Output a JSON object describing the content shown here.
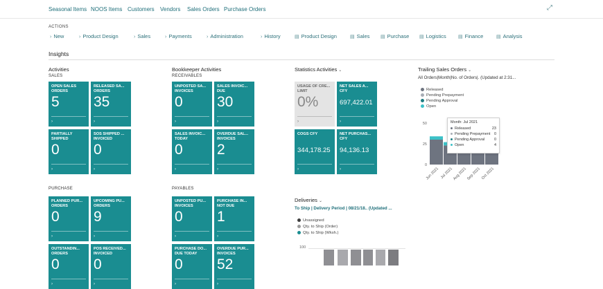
{
  "top_nav": [
    "Seasonal Items",
    "NOOS Items",
    "Customers",
    "Vendors",
    "Sales Orders",
    "Purchase Orders"
  ],
  "actions_label": "ACTIONS",
  "actions": [
    {
      "label": "New",
      "icon": "chevron-right-icon"
    },
    {
      "label": "Product Design",
      "icon": "chevron-right-icon"
    },
    {
      "label": "Sales",
      "icon": "chevron-right-icon"
    },
    {
      "label": "Payments",
      "icon": "chevron-right-icon"
    },
    {
      "label": "Administration",
      "icon": "chevron-right-icon"
    },
    {
      "label": "History",
      "icon": "chevron-right-icon"
    },
    {
      "label": "Product Design",
      "icon": "document-icon"
    },
    {
      "label": "Sales",
      "icon": "document-icon"
    },
    {
      "label": "Purchase",
      "icon": "document-icon"
    },
    {
      "label": "Logistics",
      "icon": "document-icon"
    },
    {
      "label": "Finance",
      "icon": "document-icon"
    },
    {
      "label": "Analysis",
      "icon": "document-icon"
    }
  ],
  "insights_title": "Insights",
  "activities": {
    "title": "Activities",
    "sales_label": "SALES",
    "purchase_label": "PURCHASE",
    "sales_tiles": [
      {
        "title": "OPEN SALES\nORDERS",
        "value": "5"
      },
      {
        "title": "RELEASED SA...\nORDERS",
        "value": "35"
      },
      {
        "title": "PARTIALLY\nSHIPPED",
        "value": "0"
      },
      {
        "title": "SOS SHIPPED ...\nINVOICED",
        "value": "0"
      }
    ],
    "purchase_tiles": [
      {
        "title": "PLANNED PUR...\nORDERS",
        "value": "0"
      },
      {
        "title": "UPCOMING PU...\nORDERS",
        "value": "9"
      },
      {
        "title": "OUTSTANDIN...\nORDERS",
        "value": "0"
      },
      {
        "title": "POS RECEIVED...\nINVOICED",
        "value": "0"
      }
    ]
  },
  "bookkeeper": {
    "title": "Bookkeeper Activities",
    "receivables_label": "RECEIVABLES",
    "payables_label": "PAYABLES",
    "receivable_tiles": [
      {
        "title": "UNPOSTED SA...\nINVOICES",
        "value": "0"
      },
      {
        "title": "SALES INVOIC...\nDUE",
        "value": "30"
      },
      {
        "title": "SALES INVOIC...\nTODAY",
        "value": "0"
      },
      {
        "title": "OVERDUE SAL...\nINVOICES",
        "value": "2"
      }
    ],
    "payable_tiles": [
      {
        "title": "UNPOSTED PU...\nINVOICES",
        "value": "0"
      },
      {
        "title": "PURCHASE IN...\nNOT DUE",
        "value": "1"
      },
      {
        "title": "PURCHASE DO...\nDUE TODAY",
        "value": "0"
      },
      {
        "title": "OVERDUE PUR...\nINVOICES",
        "value": "52"
      }
    ]
  },
  "statistics": {
    "title": "Statistics Activities",
    "tiles": [
      {
        "title": "USAGE OF CRE...\nLIMIT",
        "value": "0%"
      },
      {
        "title": "NET SALES A...\nCFY",
        "value": "697,422.01"
      },
      {
        "title": "COGS CFY",
        "value": "344,178.25"
      },
      {
        "title": "NET PURCHAS...\nCFY",
        "value": "94,136.13"
      }
    ]
  },
  "deliveries": {
    "title": "Deliveries",
    "subtitle": "To Ship | Delivery Period | 08/21/18.. (Updated ...",
    "legend": [
      "Unassigned",
      "Qty. to Ship (Order)",
      "Qty. to Ship (Wksh.)"
    ],
    "y_label": "100"
  },
  "trailing": {
    "title": "Trailing Sales Orders",
    "subtitle": "All Orders|Month|No. of Orders|. (Updated at 2:31...",
    "tooltip": {
      "header": "Month: Jul 2021",
      "rows": [
        {
          "label": "Released",
          "value": "23"
        },
        {
          "label": "Pending Prepayment",
          "value": "0"
        },
        {
          "label": "Pending Approval",
          "value": "0"
        },
        {
          "label": "Open",
          "value": "4"
        }
      ]
    }
  },
  "chart_data": {
    "type": "bar",
    "stacked": true,
    "categories": [
      "Jun 2021",
      "Jul 2021",
      "Aug 2021",
      "Sep 2021",
      "Oct 2021"
    ],
    "series": [
      {
        "name": "Released",
        "values": [
          30,
          23,
          28,
          29,
          31
        ],
        "color": "#6e7480"
      },
      {
        "name": "Pending Prepayment",
        "values": [
          0,
          0,
          0,
          0,
          0
        ],
        "color": "#a8adb5"
      },
      {
        "name": "Pending Approval",
        "values": [
          0,
          0,
          0,
          0,
          0
        ],
        "color": "#1d7d82"
      },
      {
        "name": "Open",
        "values": [
          4,
          4,
          4,
          3,
          4
        ],
        "color": "#3cc1c7"
      }
    ],
    "y_ticks": [
      0,
      25,
      50
    ],
    "ylim": [
      0,
      50
    ]
  }
}
